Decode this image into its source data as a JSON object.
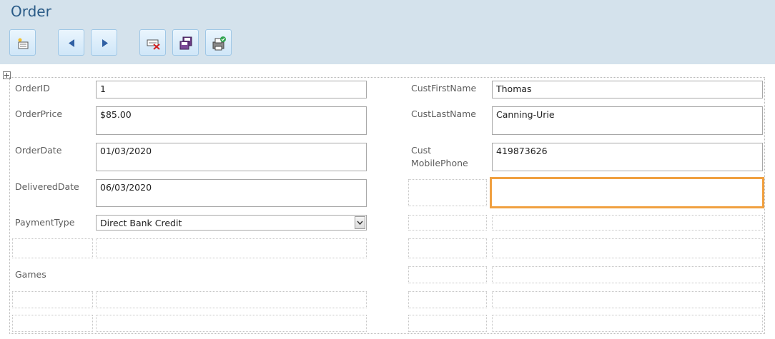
{
  "header": {
    "title": "Order",
    "toolbar": [
      {
        "name": "new-record-button",
        "icon": "new-record-icon"
      },
      {
        "name": "previous-record-button",
        "icon": "arrow-left-icon"
      },
      {
        "name": "next-record-button",
        "icon": "arrow-right-icon"
      },
      {
        "name": "delete-record-button",
        "icon": "delete-record-icon"
      },
      {
        "name": "save-record-button",
        "icon": "save-icon"
      },
      {
        "name": "print-record-button",
        "icon": "print-icon"
      }
    ]
  },
  "form": {
    "left": {
      "order_id": {
        "label": "OrderID",
        "value": "1"
      },
      "order_price": {
        "label": "OrderPrice",
        "value": "$85.00"
      },
      "order_date": {
        "label": "OrderDate",
        "value": "01/03/2020"
      },
      "delivered_date": {
        "label": "DeliveredDate",
        "value": "06/03/2020"
      },
      "payment_type": {
        "label": "PaymentType",
        "value": "Direct Bank Credit"
      },
      "games": {
        "label": "Games"
      }
    },
    "right": {
      "cust_first_name": {
        "label": "CustFirstName",
        "value": "Thomas"
      },
      "cust_last_name": {
        "label": "CustLastName",
        "value": "Canning-Urie"
      },
      "cust_mobile_phone": {
        "label_line1": "Cust",
        "label_line2": "MobilePhone",
        "value": "419873626"
      }
    }
  },
  "colors": {
    "header_bg": "#d4e2ec",
    "title": "#2a5b87",
    "focus_border": "#f0a040"
  }
}
